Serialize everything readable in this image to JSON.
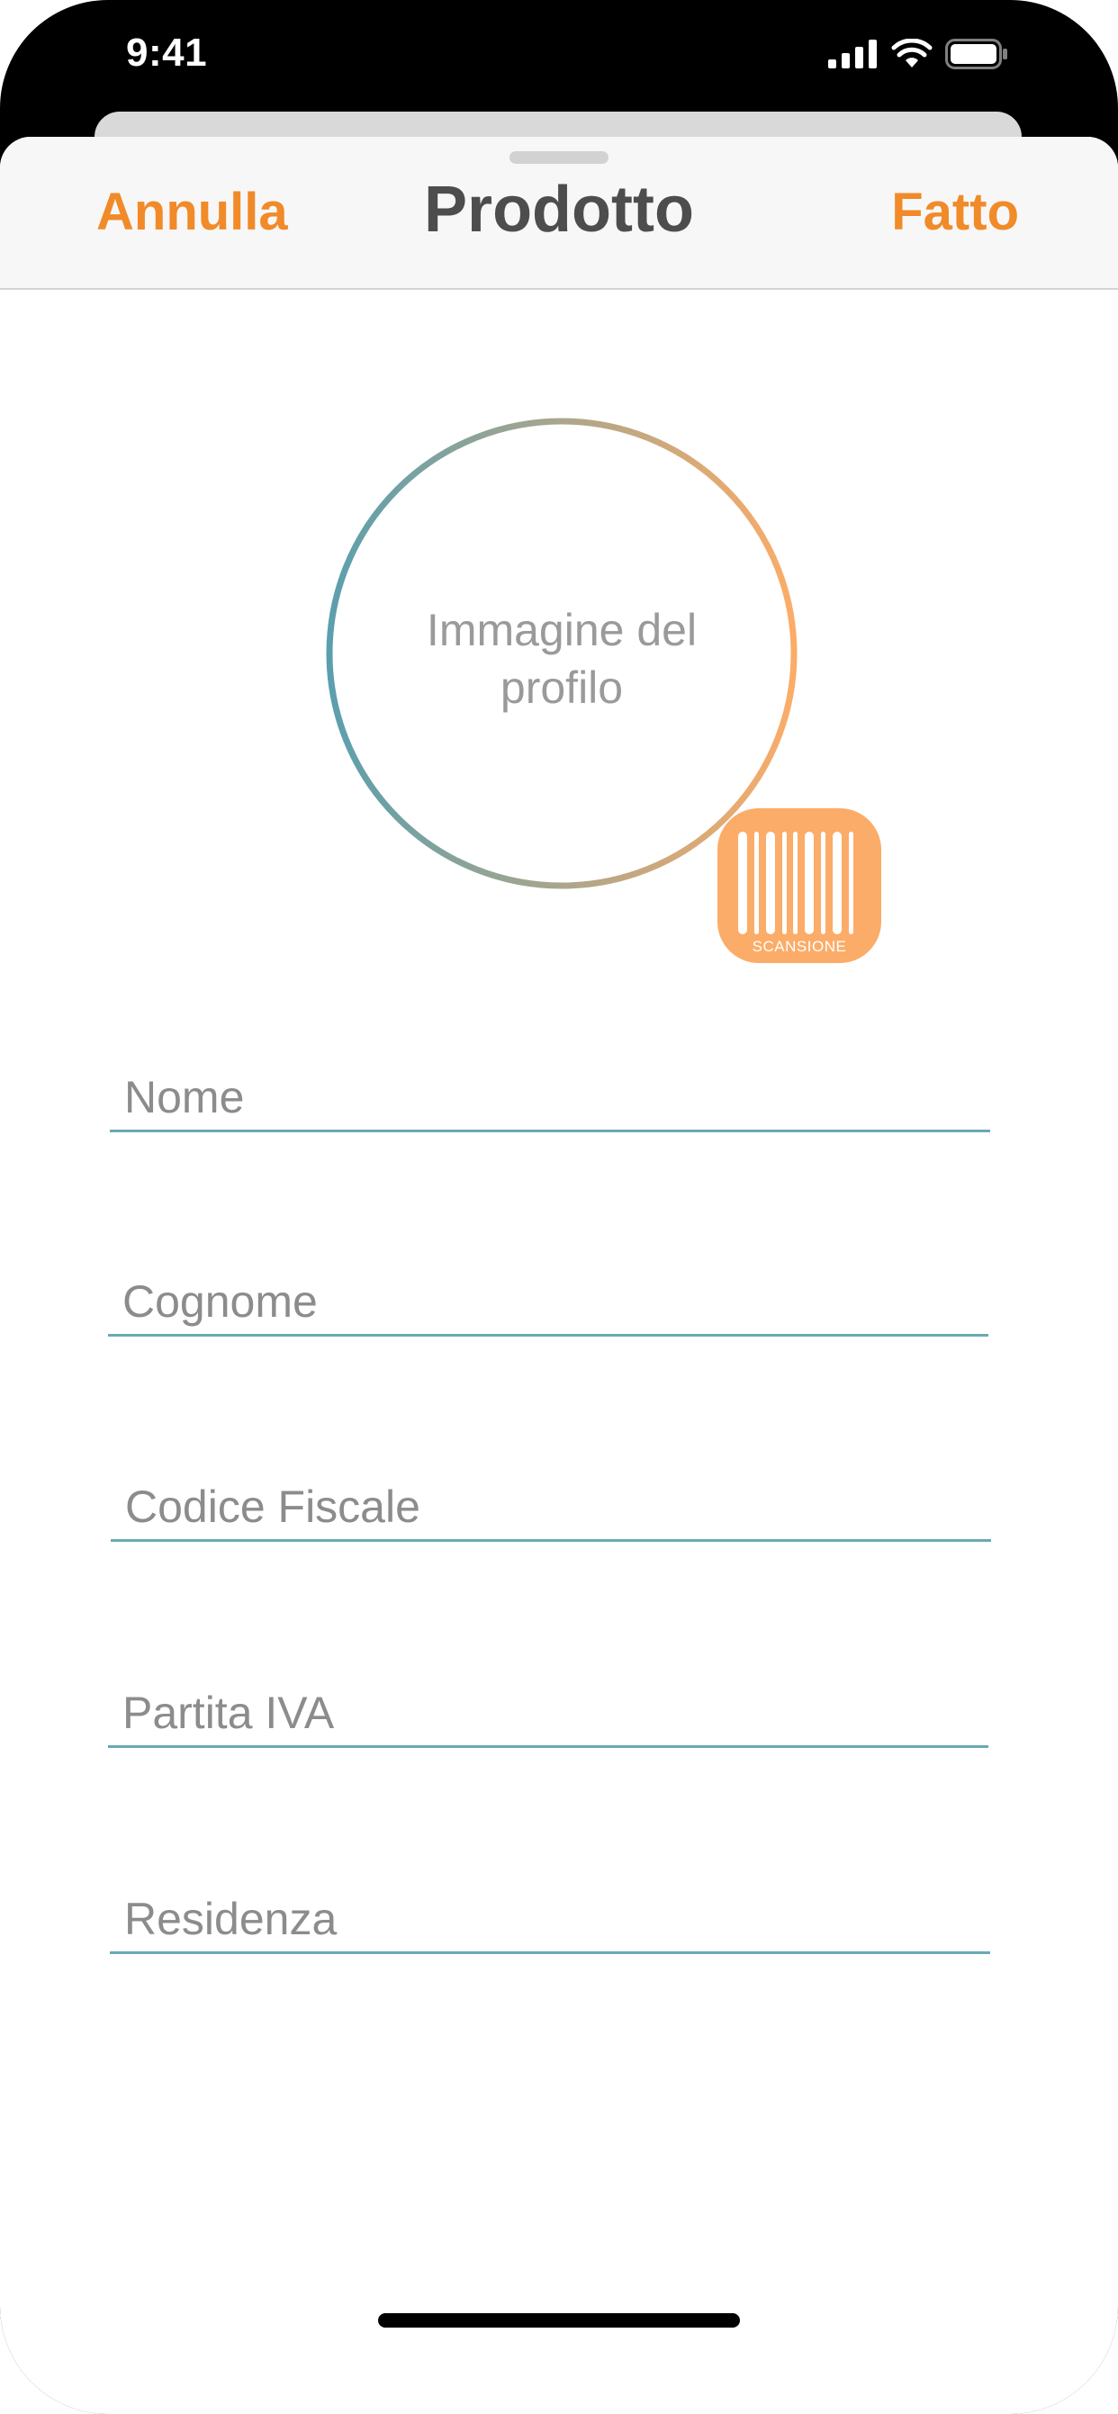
{
  "status_bar": {
    "time": "9:41",
    "icons": [
      "signal-icon",
      "wifi-icon",
      "battery-icon"
    ]
  },
  "nav": {
    "cancel_label": "Annulla",
    "title": "Prodotto",
    "done_label": "Fatto"
  },
  "profile": {
    "placeholder_text": "Immagine del profilo",
    "ring_gradient": [
      "#5b9fae",
      "#fbac68"
    ]
  },
  "scan": {
    "label": "SCANSIONE",
    "icon": "barcode-icon",
    "color": "#fbac68"
  },
  "form": {
    "fields": [
      {
        "placeholder": "Nome",
        "value": ""
      },
      {
        "placeholder": "Cognome",
        "value": ""
      },
      {
        "placeholder": "Codice Fiscale",
        "value": ""
      },
      {
        "placeholder": "Partita IVA",
        "value": ""
      },
      {
        "placeholder": "Residenza",
        "value": ""
      }
    ]
  },
  "colors": {
    "accent": "#f18a28",
    "underline": "#6aa9b5",
    "title": "#4d4d4d",
    "placeholder": "#8c8c8c"
  }
}
